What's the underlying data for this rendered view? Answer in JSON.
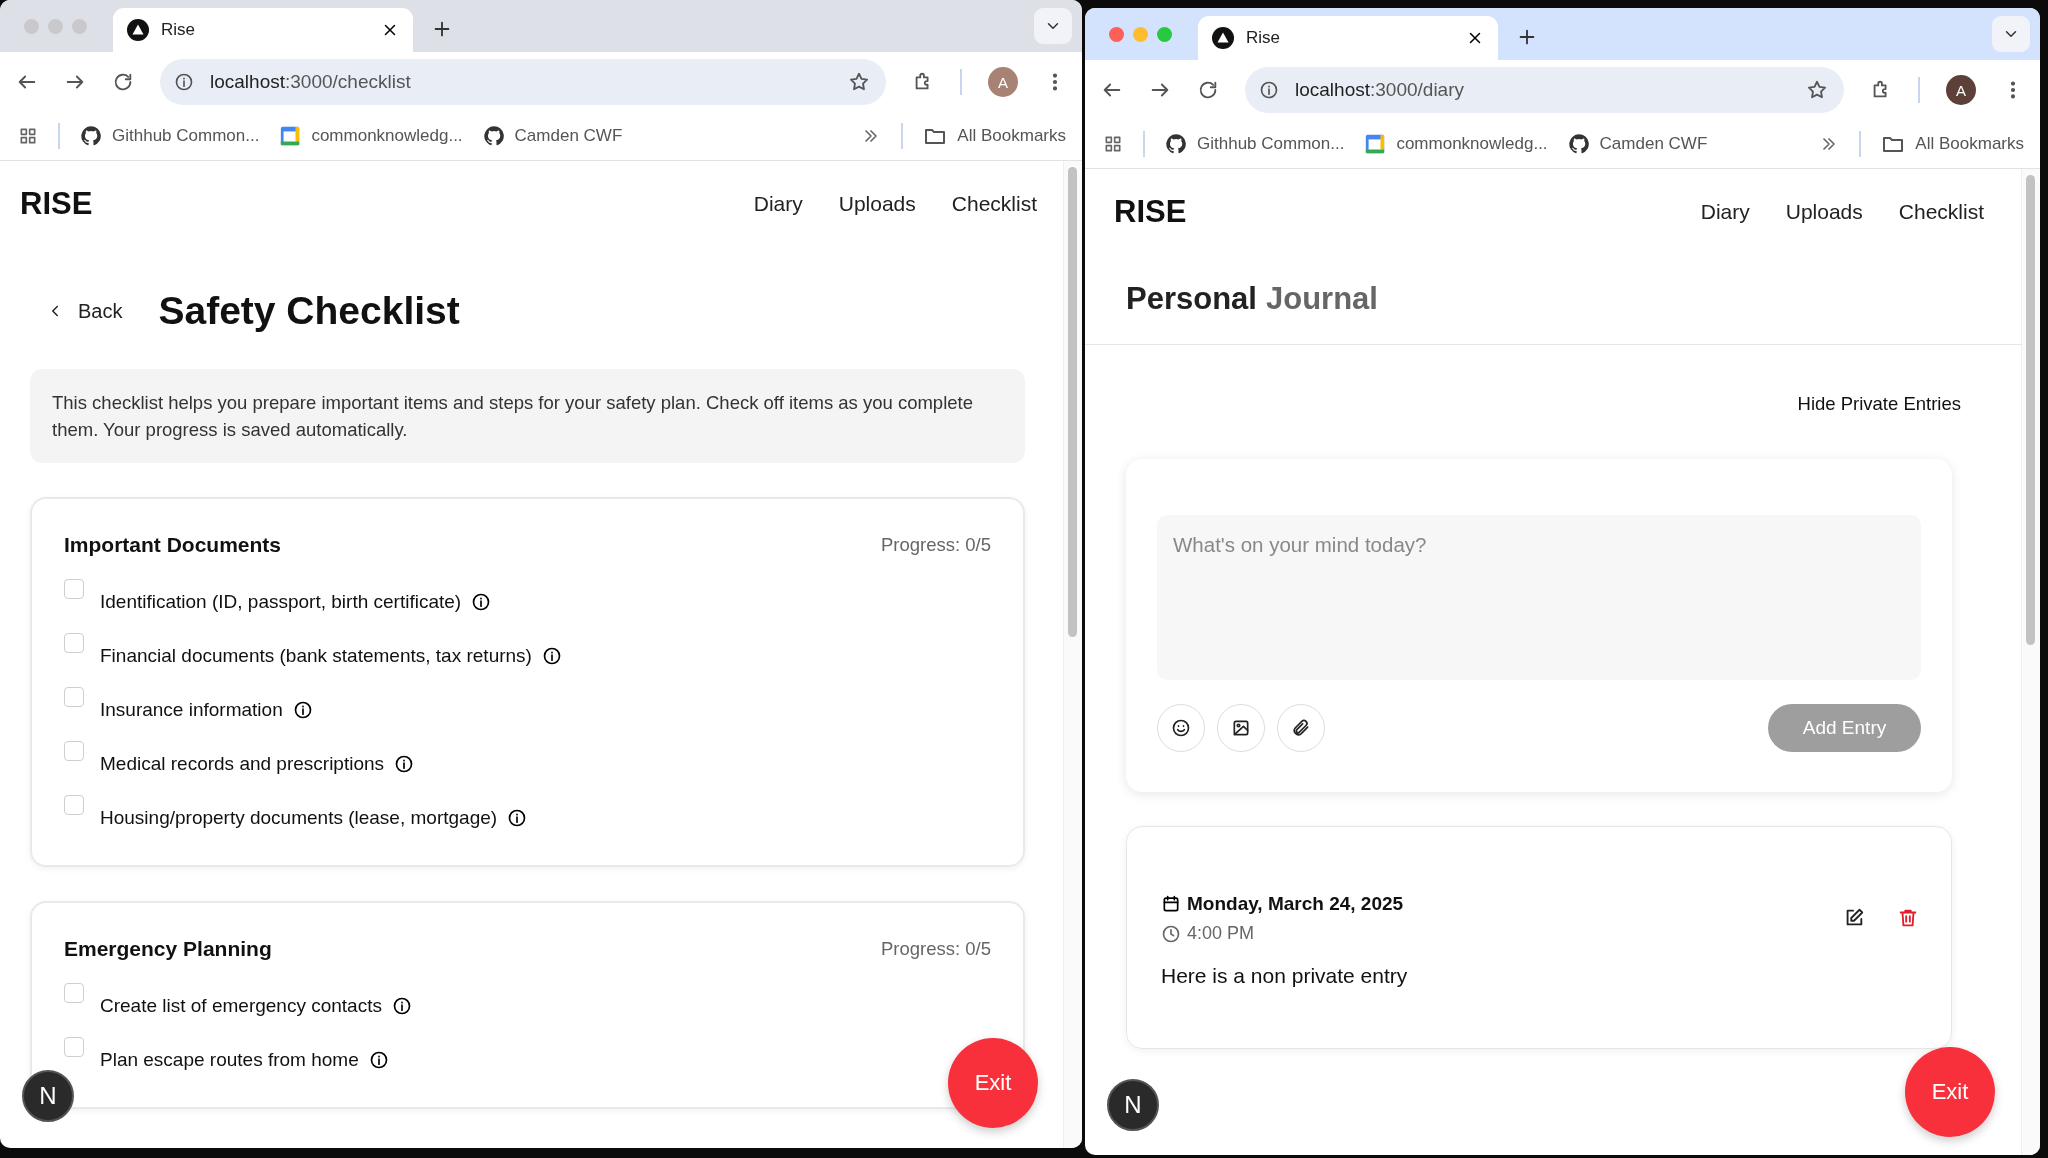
{
  "windows": [
    {
      "kind": "checklist",
      "focused": false,
      "tab_title": "Rise",
      "url_host": "localhost",
      "url_path": ":3000/checklist",
      "profile_initial": "A",
      "bookmarks": [
        {
          "kind": "github",
          "label": "Githhub Common..."
        },
        {
          "kind": "calendar",
          "label": "commonknowledg..."
        },
        {
          "kind": "github",
          "label": "Camden CWF"
        }
      ],
      "all_bookmarks": "All Bookmarks",
      "nav": {
        "logo": "RISE",
        "links": [
          "Diary",
          "Uploads",
          "Checklist"
        ]
      },
      "back": "Back",
      "title": "Safety Checklist",
      "intro": "This checklist helps you prepare important items and steps for your safety plan. Check off items as you complete them. Your progress is saved automatically.",
      "sections": [
        {
          "title": "Important Documents",
          "progress": "Progress: 0/5",
          "items": [
            {
              "label": "Identification (ID, passport, birth certificate)",
              "checked": false
            },
            {
              "label": "Financial documents (bank statements, tax returns)",
              "checked": false
            },
            {
              "label": "Insurance information",
              "checked": false
            },
            {
              "label": "Medical records and prescriptions",
              "checked": false
            },
            {
              "label": "Housing/property documents (lease, mortgage)",
              "checked": false
            }
          ]
        },
        {
          "title": "Emergency Planning",
          "progress": "Progress: 0/5",
          "items": [
            {
              "label": "Create list of emergency contacts",
              "checked": false
            },
            {
              "label": "Plan escape routes from home",
              "checked": false
            }
          ]
        }
      ],
      "exit": "Exit",
      "dev_badge": "N"
    },
    {
      "kind": "diary",
      "focused": true,
      "tab_title": "Rise",
      "url_host": "localhost",
      "url_path": ":3000/diary",
      "profile_initial": "A",
      "bookmarks": [
        {
          "kind": "github",
          "label": "Githhub Common..."
        },
        {
          "kind": "calendar",
          "label": "commonknowledg..."
        },
        {
          "kind": "github",
          "label": "Camden CWF"
        }
      ],
      "all_bookmarks": "All Bookmarks",
      "nav": {
        "logo": "RISE",
        "links": [
          "Diary",
          "Uploads",
          "Checklist"
        ]
      },
      "title_main": "Personal",
      "title_accent": "Journal",
      "toggle": "Hide Private Entries",
      "composer": {
        "placeholder": "What's on your mind today?",
        "submit": "Add Entry",
        "submit_disabled": true
      },
      "entries": [
        {
          "date": "Monday, March 24, 2025",
          "time": "4:00 PM",
          "text": "Here is a non private entry"
        }
      ],
      "exit": "Exit",
      "dev_badge": "N"
    }
  ]
}
